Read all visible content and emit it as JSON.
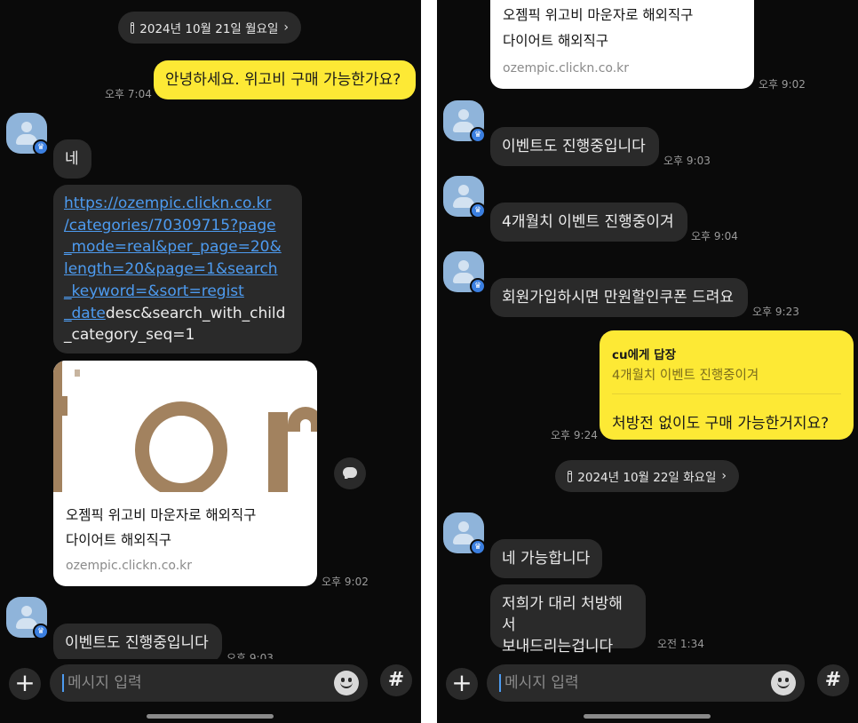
{
  "left": {
    "date_pill": "2024년 10월 21일 월요일",
    "messages": {
      "out_hello": {
        "text": "안녕하세요. 위고비 구매 가능한가요?",
        "time": "오후 7:04"
      },
      "in_yes": {
        "text": "네"
      },
      "link": {
        "url_lines": [
          "https://ozempic.clickn.co.kr",
          "/categories/70309715?page",
          "_mode=real&per_page=20&",
          "length=20&page=1&search",
          "_keyword=&sort=regist"
        ],
        "mixed_link": "_date",
        "mixed_rest": "desc&search_with_child",
        "last_line": "_category_seq=1"
      },
      "card": {
        "title1": "오젬픽 위고비 마운자로 해외직구",
        "title2": "다이어트 해외직구",
        "url": "ozempic.clickn.co.kr",
        "time": "오후 9:02"
      },
      "in_event": {
        "text": "이벤트도 진행중입니다",
        "time": "오후 9:03"
      }
    },
    "input_placeholder": "메시지 입력"
  },
  "right": {
    "card": {
      "title1": "오젬픽 위고비 마운자로 해외직구",
      "title2": "다이어트 해외직구",
      "url": "ozempic.clickn.co.kr",
      "time": "오후 9:02"
    },
    "messages": {
      "m1": {
        "text": "이벤트도 진행중입니다",
        "time": "오후 9:03"
      },
      "m2": {
        "text": "4개월치 이벤트 진행중이겨",
        "time": "오후 9:04"
      },
      "m3": {
        "text": "회원가입하시면 만원할인쿠폰 드려요",
        "time": "오후 9:23"
      }
    },
    "reply": {
      "to": "cu에게 답장",
      "quote": "4개월치 이벤트 진행중이겨",
      "text": "처방전 없이도 구매 가능한거지요?",
      "time": "오후 9:24"
    },
    "date_pill": "2024년 10월 22일 화요일",
    "messages2": {
      "m4": {
        "text": "네 가능합니다"
      },
      "m5": {
        "line1": "저희가 대리 처방해서",
        "line2": "보내드리는겁니다",
        "time": "오전 1:34"
      }
    },
    "input_placeholder": "메시지 입력"
  },
  "colors": {
    "background": "#0a0a0a",
    "bubble_dark": "#2a2a2a",
    "bubble_yellow": "#fde935",
    "link": "#4d9bf0"
  },
  "icons": [
    "calendar-icon",
    "chevron-right-icon",
    "plus-icon",
    "emoji-icon",
    "hash-icon",
    "share-icon",
    "avatar-icon"
  ]
}
